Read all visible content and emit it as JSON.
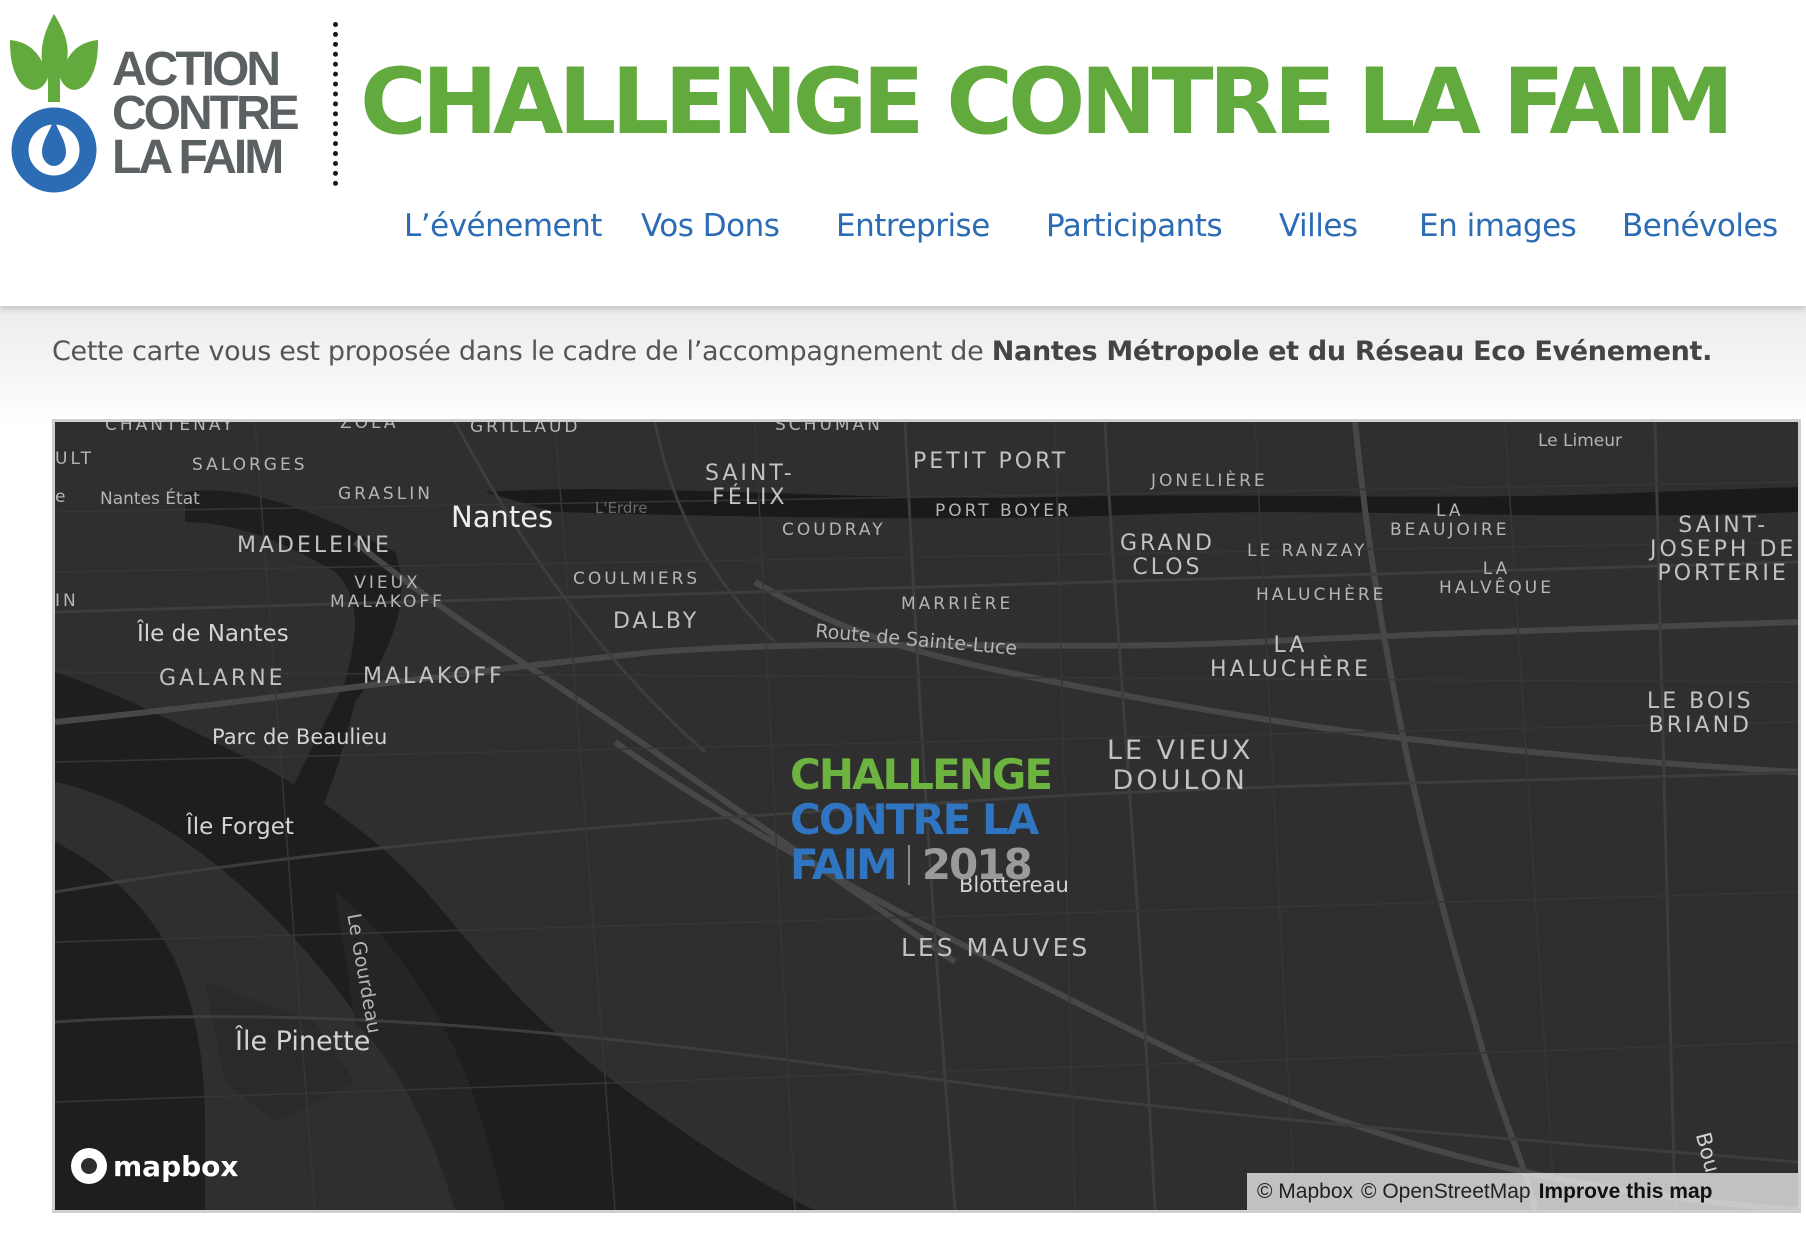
{
  "header": {
    "logo": {
      "lines": [
        "ACTION",
        "CONTRE",
        "LA FAIM"
      ]
    },
    "title": "CHALLENGE CONTRE LA FAIM"
  },
  "nav": {
    "items": [
      {
        "label": "L’événement"
      },
      {
        "label": "Vos Dons"
      },
      {
        "label": "Entreprise"
      },
      {
        "label": "Participants"
      },
      {
        "label": "Villes"
      },
      {
        "label": "En images"
      },
      {
        "label": "Benévoles"
      }
    ]
  },
  "intro": {
    "text": "Cette carte vous est proposée dans le cadre de l’accompagnement de ",
    "bold": "Nantes Métropole et du Réseau Eco Evénement."
  },
  "map": {
    "event_logo": {
      "line1": "CHALLENGE",
      "line2": "CONTRE LA",
      "line3": "FAIM",
      "year": "2018"
    },
    "labels": {
      "chantenay": "CHANTENAY",
      "zola": "ZOLA",
      "grillaud": "GRILLAUD",
      "schuman": "SCHUMAN",
      "ult": "ULT",
      "salorges": "SALORGES",
      "e": "e",
      "nantes_etat": "Nantes État",
      "graslin": "GRASLIN",
      "nantes": "Nantes",
      "erdre": "L'Erdre",
      "saint_felix": "SAINT-\nFÉLIX",
      "petit_port": "PETIT PORT",
      "port_boyer": "PORT BOYER",
      "joneliere": "JONELIÈRE",
      "le_limeur": "Le Limeur",
      "madeleine": "MADELEINE",
      "coudray": "COUDRAY",
      "grand_clos": "GRAND\nCLOS",
      "le_ranzay": "LE RANZAY",
      "la_beaujoire": "LA\nBEAUJOIRE",
      "saint_joseph": "SAINT-\nJOSEPH DE\nPORTERIE",
      "in": "IN",
      "vieux_malakoff": "VIEUX\nMALAKOFF",
      "coulmiers": "COULMIERS",
      "marriere": "MARRIÈRE",
      "haluchere": "HALUCHÈRE",
      "la_halveque": "LA\nHALVÊQUE",
      "ile_de_nantes": "Île de Nantes",
      "dalby": "DALBY",
      "route_sainte_luce": "Route de Sainte-Luce",
      "la_haluchere": "LA\nHALUCHÈRE",
      "galarne": "GALARNE",
      "malakoff": "MALAKOFF",
      "le_bois_briand": "LE BOIS\nBRIAND",
      "parc_de_beaulieu": "Parc de Beaulieu",
      "le_vieux_doulon": "LE VIEUX\nDOULON",
      "ile_forget": "Île Forget",
      "le_gourdeau": "Le Gourdeau",
      "blottereau": "Blottereau",
      "les_mauves": "LES MAUVES",
      "ile_pinette": "Île Pinette",
      "bou": "Bou"
    },
    "mapbox_logo": "mapbox",
    "attribution": {
      "mapbox": "© Mapbox",
      "osm": "© OpenStreetMap",
      "improve": "Improve this map"
    }
  },
  "colors": {
    "green": "#62aa3d",
    "blue": "#2b6cb5",
    "map_bg": "#2f2f2f"
  }
}
